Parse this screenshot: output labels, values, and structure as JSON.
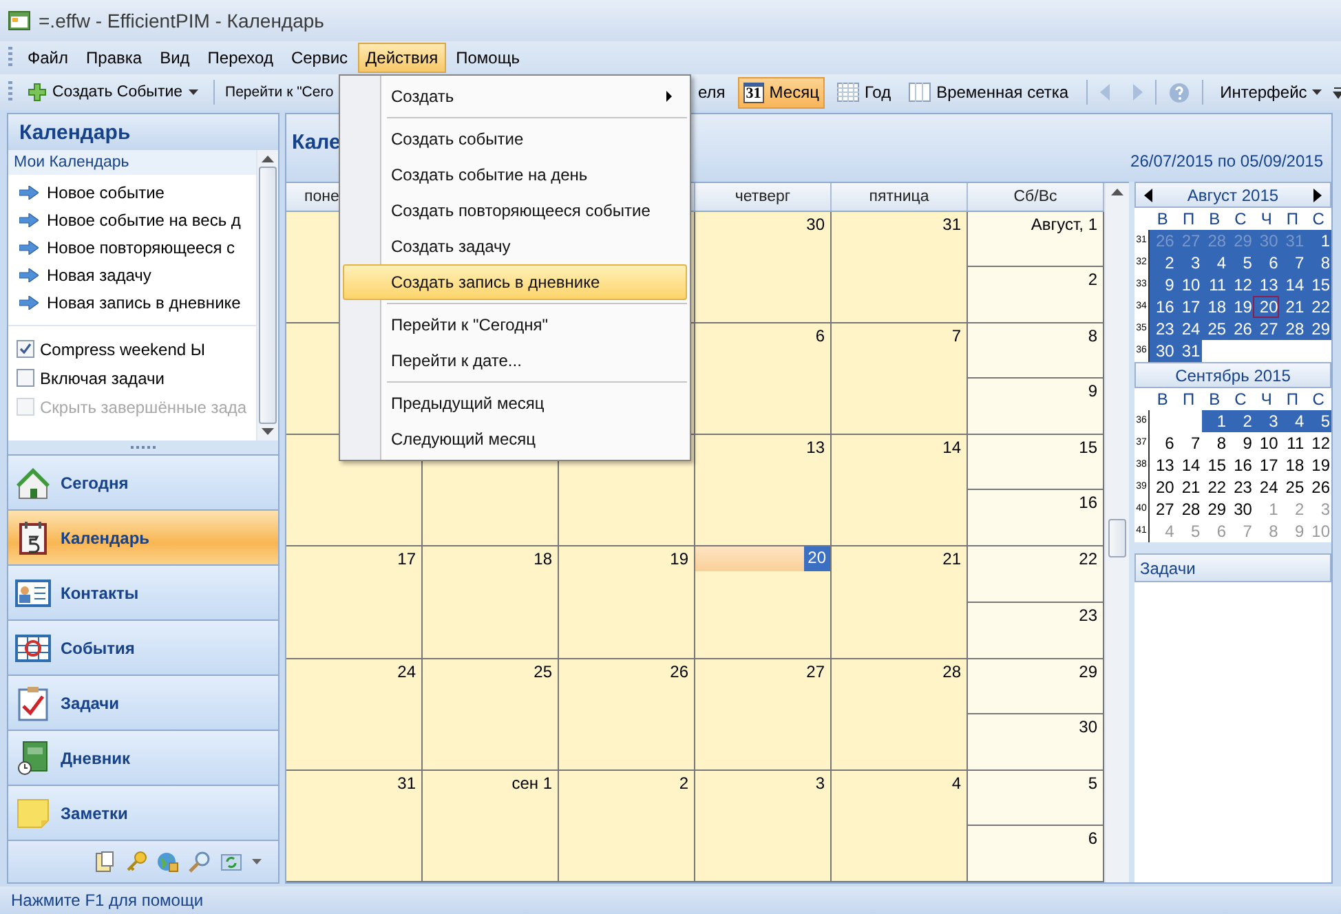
{
  "window": {
    "title": "=.effw - EfficientPIM - Календарь"
  },
  "menu_bar": [
    {
      "label": "Файл",
      "selected": false
    },
    {
      "label": "Правка",
      "selected": false
    },
    {
      "label": "Вид",
      "selected": false
    },
    {
      "label": "Переход",
      "selected": false
    },
    {
      "label": "Сервис",
      "selected": false
    },
    {
      "label": "Действия",
      "selected": true
    },
    {
      "label": "Помощь",
      "selected": false
    }
  ],
  "toolbar": {
    "create": "Создать Событие",
    "goto": "Перейти к \"Сего",
    "views": [
      {
        "label": "еля",
        "selected": false
      },
      {
        "label": "Месяц",
        "icon_text": "31",
        "selected": true
      },
      {
        "label": "Год",
        "selected": false
      },
      {
        "label": "Временная сетка",
        "selected": false
      }
    ],
    "interface": "Интерфейс"
  },
  "actions_menu": [
    {
      "kind": "submenu",
      "label": "Создать",
      "selected": false
    },
    {
      "kind": "separator"
    },
    {
      "kind": "item",
      "label": "Создать событие",
      "selected": false
    },
    {
      "kind": "item",
      "label": "Создать событие на день",
      "selected": false
    },
    {
      "kind": "item",
      "label": "Создать повторяющееся событие",
      "selected": false
    },
    {
      "kind": "item",
      "label": "Создать задачу",
      "selected": false
    },
    {
      "kind": "item",
      "label": "Создать запись в дневнике",
      "selected": true
    },
    {
      "kind": "separator"
    },
    {
      "kind": "item",
      "label": "Перейти к \"Сегодня\"",
      "selected": false
    },
    {
      "kind": "item",
      "label": "Перейти к дате...",
      "selected": false
    },
    {
      "kind": "separator"
    },
    {
      "kind": "item",
      "label": "Предыдущий месяц",
      "selected": false
    },
    {
      "kind": "item",
      "label": "Следующий месяц",
      "selected": false
    }
  ],
  "sidebar": {
    "title": "Календарь",
    "section": "Мои Календарь",
    "links": [
      "Новое событие",
      "Новое событие на весь д",
      "Новое повторяющееся с",
      "Новая задачу",
      "Новая запись в дневнике"
    ],
    "options": [
      {
        "label": "Compress weekend Ы",
        "checked": true,
        "disabled": false
      },
      {
        "label": "Включая задачи",
        "checked": false,
        "disabled": false
      },
      {
        "label": "Скрыть завершённые зада",
        "checked": false,
        "disabled": true
      }
    ],
    "nav": [
      {
        "label": "Сегодня",
        "selected": false
      },
      {
        "label": "Календарь",
        "selected": true
      },
      {
        "label": "Контакты",
        "selected": false
      },
      {
        "label": "События",
        "selected": false
      },
      {
        "label": "Задачи",
        "selected": false
      },
      {
        "label": "Дневник",
        "selected": false
      },
      {
        "label": "Заметки",
        "selected": false
      }
    ]
  },
  "calendar": {
    "title": "Кале",
    "range": "26/07/2015 по 05/09/2015",
    "columns": [
      "поне",
      "четверг",
      "пятница",
      "Сб/Вс"
    ],
    "weeks": [
      {
        "days": [
          {
            "label": "30",
            "today": false
          },
          {
            "label": "31",
            "today": false
          }
        ],
        "weekend": [
          "Август, 1",
          "2"
        ]
      },
      {
        "days": [
          {
            "label": "6",
            "today": false
          },
          {
            "label": "7",
            "today": false
          }
        ],
        "weekend": [
          "8",
          "9"
        ]
      },
      {
        "days": [
          {
            "label": "13",
            "today": false
          },
          {
            "label": "14",
            "today": false
          }
        ],
        "weekend": [
          "15",
          "16"
        ]
      },
      {
        "days": [
          {
            "label": "17",
            "today": false
          },
          {
            "label": "18",
            "today": false
          },
          {
            "label": "19",
            "today": false
          },
          {
            "label": "20",
            "today": true
          },
          {
            "label": "21",
            "today": false
          }
        ],
        "weekend": [
          "22",
          "23"
        ]
      },
      {
        "days": [
          {
            "label": "24",
            "today": false
          },
          {
            "label": "25",
            "today": false
          },
          {
            "label": "26",
            "today": false
          },
          {
            "label": "27",
            "today": false
          },
          {
            "label": "28",
            "today": false
          }
        ],
        "weekend": [
          "29",
          "30"
        ]
      },
      {
        "days": [
          {
            "label": "31",
            "today": false
          },
          {
            "label": "сен 1",
            "today": false
          },
          {
            "label": "2",
            "today": false
          },
          {
            "label": "3",
            "today": false
          },
          {
            "label": "4",
            "today": false
          }
        ],
        "weekend": [
          "5",
          "6"
        ]
      }
    ]
  },
  "mini_months": [
    {
      "title": "Август 2015",
      "arrows": true,
      "weekdays": [
        "В",
        "П",
        "В",
        "С",
        "Ч",
        "П",
        "С"
      ],
      "weeks": [
        {
          "num": "31",
          "days": [
            {
              "d": "26",
              "other": true,
              "selected": true,
              "today": false
            },
            {
              "d": "27",
              "other": true,
              "selected": true,
              "today": false
            },
            {
              "d": "28",
              "other": true,
              "selected": true,
              "today": false
            },
            {
              "d": "29",
              "other": true,
              "selected": true,
              "today": false
            },
            {
              "d": "30",
              "other": true,
              "selected": true,
              "today": false
            },
            {
              "d": "31",
              "other": true,
              "selected": true,
              "today": false
            },
            {
              "d": "1",
              "other": false,
              "selected": true,
              "today": false
            }
          ]
        },
        {
          "num": "32",
          "days": [
            {
              "d": "2",
              "other": false,
              "selected": true,
              "today": false
            },
            {
              "d": "3",
              "other": false,
              "selected": true,
              "today": false
            },
            {
              "d": "4",
              "other": false,
              "selected": true,
              "today": false
            },
            {
              "d": "5",
              "other": false,
              "selected": true,
              "today": false
            },
            {
              "d": "6",
              "other": false,
              "selected": true,
              "today": false
            },
            {
              "d": "7",
              "other": false,
              "selected": true,
              "today": false
            },
            {
              "d": "8",
              "other": false,
              "selected": true,
              "today": false
            }
          ]
        },
        {
          "num": "33",
          "days": [
            {
              "d": "9",
              "other": false,
              "selected": true,
              "today": false
            },
            {
              "d": "10",
              "other": false,
              "selected": true,
              "today": false
            },
            {
              "d": "11",
              "other": false,
              "selected": true,
              "today": false
            },
            {
              "d": "12",
              "other": false,
              "selected": true,
              "today": false
            },
            {
              "d": "13",
              "other": false,
              "selected": true,
              "today": false
            },
            {
              "d": "14",
              "other": false,
              "selected": true,
              "today": false
            },
            {
              "d": "15",
              "other": false,
              "selected": true,
              "today": false
            }
          ]
        },
        {
          "num": "34",
          "days": [
            {
              "d": "16",
              "other": false,
              "selected": true,
              "today": false
            },
            {
              "d": "17",
              "other": false,
              "selected": true,
              "today": false
            },
            {
              "d": "18",
              "other": false,
              "selected": true,
              "today": false
            },
            {
              "d": "19",
              "other": false,
              "selected": true,
              "today": false
            },
            {
              "d": "20",
              "other": false,
              "selected": true,
              "today": true
            },
            {
              "d": "21",
              "other": false,
              "selected": true,
              "today": false
            },
            {
              "d": "22",
              "other": false,
              "selected": true,
              "today": false
            }
          ]
        },
        {
          "num": "35",
          "days": [
            {
              "d": "23",
              "other": false,
              "selected": true,
              "today": false
            },
            {
              "d": "24",
              "other": false,
              "selected": true,
              "today": false
            },
            {
              "d": "25",
              "other": false,
              "selected": true,
              "today": false
            },
            {
              "d": "26",
              "other": false,
              "selected": true,
              "today": false
            },
            {
              "d": "27",
              "other": false,
              "selected": true,
              "today": false
            },
            {
              "d": "28",
              "other": false,
              "selected": true,
              "today": false
            },
            {
              "d": "29",
              "other": false,
              "selected": true,
              "today": false
            }
          ]
        },
        {
          "num": "36",
          "days": [
            {
              "d": "30",
              "other": false,
              "selected": true,
              "today": false
            },
            {
              "d": "31",
              "other": false,
              "selected": true,
              "today": false
            }
          ]
        }
      ]
    },
    {
      "title": "Сентябрь 2015",
      "arrows": false,
      "weekdays": [
        "В",
        "П",
        "В",
        "С",
        "Ч",
        "П",
        "С"
      ],
      "weeks": [
        {
          "num": "36",
          "days": [
            {
              "d": "1",
              "other": false,
              "selected": true,
              "today": false
            },
            {
              "d": "2",
              "other": false,
              "selected": true,
              "today": false
            },
            {
              "d": "3",
              "other": false,
              "selected": true,
              "today": false
            },
            {
              "d": "4",
              "other": false,
              "selected": true,
              "today": false
            },
            {
              "d": "5",
              "other": false,
              "selected": true,
              "today": false
            }
          ]
        },
        {
          "num": "37",
          "days": [
            {
              "d": "6",
              "other": false,
              "selected": false,
              "today": false
            },
            {
              "d": "7",
              "other": false,
              "selected": false,
              "today": false
            },
            {
              "d": "8",
              "other": false,
              "selected": false,
              "today": false
            },
            {
              "d": "9",
              "other": false,
              "selected": false,
              "today": false
            },
            {
              "d": "10",
              "other": false,
              "selected": false,
              "today": false
            },
            {
              "d": "11",
              "other": false,
              "selected": false,
              "today": false
            },
            {
              "d": "12",
              "other": false,
              "selected": false,
              "today": false
            }
          ]
        },
        {
          "num": "38",
          "days": [
            {
              "d": "13",
              "other": false,
              "selected": false,
              "today": false
            },
            {
              "d": "14",
              "other": false,
              "selected": false,
              "today": false
            },
            {
              "d": "15",
              "other": false,
              "selected": false,
              "today": false
            },
            {
              "d": "16",
              "other": false,
              "selected": false,
              "today": false
            },
            {
              "d": "17",
              "other": false,
              "selected": false,
              "today": false
            },
            {
              "d": "18",
              "other": false,
              "selected": false,
              "today": false
            },
            {
              "d": "19",
              "other": false,
              "selected": false,
              "today": false
            }
          ]
        },
        {
          "num": "39",
          "days": [
            {
              "d": "20",
              "other": false,
              "selected": false,
              "today": false
            },
            {
              "d": "21",
              "other": false,
              "selected": false,
              "today": false
            },
            {
              "d": "22",
              "other": false,
              "selected": false,
              "today": false
            },
            {
              "d": "23",
              "other": false,
              "selected": false,
              "today": false
            },
            {
              "d": "24",
              "other": false,
              "selected": false,
              "today": false
            },
            {
              "d": "25",
              "other": false,
              "selected": false,
              "today": false
            },
            {
              "d": "26",
              "other": false,
              "selected": false,
              "today": false
            }
          ]
        },
        {
          "num": "40",
          "days": [
            {
              "d": "27",
              "other": false,
              "selected": false,
              "today": false
            },
            {
              "d": "28",
              "other": false,
              "selected": false,
              "today": false
            },
            {
              "d": "29",
              "other": false,
              "selected": false,
              "today": false
            },
            {
              "d": "30",
              "other": false,
              "selected": false,
              "today": false
            },
            {
              "d": "1",
              "other": true,
              "selected": false,
              "today": false
            },
            {
              "d": "2",
              "other": true,
              "selected": false,
              "today": false
            },
            {
              "d": "3",
              "other": true,
              "selected": false,
              "today": false
            }
          ]
        },
        {
          "num": "41",
          "days": [
            {
              "d": "4",
              "other": true,
              "selected": false,
              "today": false
            },
            {
              "d": "5",
              "other": true,
              "selected": false,
              "today": false
            },
            {
              "d": "6",
              "other": true,
              "selected": false,
              "today": false
            },
            {
              "d": "7",
              "other": true,
              "selected": false,
              "today": false
            },
            {
              "d": "8",
              "other": true,
              "selected": false,
              "today": false
            },
            {
              "d": "9",
              "other": true,
              "selected": false,
              "today": false
            },
            {
              "d": "10",
              "other": true,
              "selected": false,
              "today": false
            }
          ]
        }
      ]
    }
  ],
  "tasks": {
    "title": "Задачи"
  },
  "status_bar": "Нажмите F1 для помощи"
}
